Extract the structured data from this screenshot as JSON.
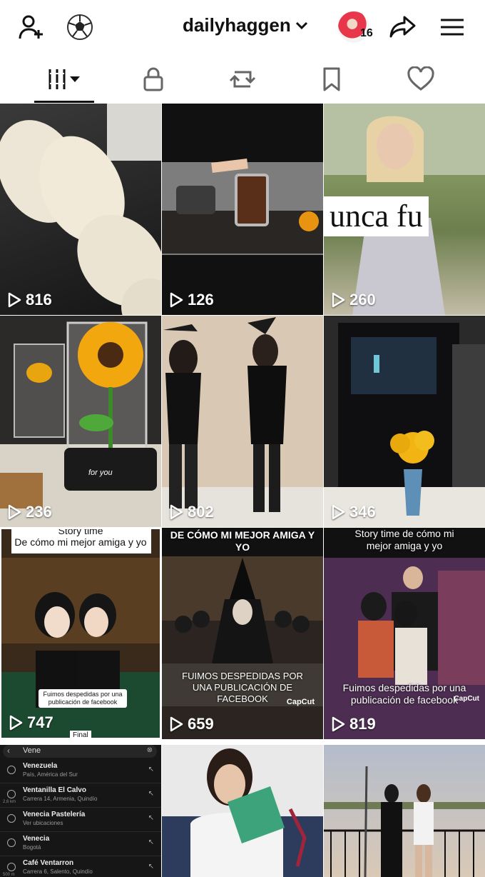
{
  "header": {
    "username": "dailyhaggen",
    "notification_count": "16",
    "icons": [
      "add-friend-icon",
      "soccer-ball-icon",
      "chevron-down-icon",
      "share-icon",
      "menu-icon"
    ]
  },
  "tabs": [
    {
      "name": "videos",
      "icon": "grid-icon",
      "active": true
    },
    {
      "name": "private",
      "icon": "lock-icon"
    },
    {
      "name": "reposts",
      "icon": "repost-icon"
    },
    {
      "name": "favorites",
      "icon": "bookmark-icon"
    },
    {
      "name": "liked",
      "icon": "heart-icon"
    }
  ],
  "videos": [
    {
      "views": "816"
    },
    {
      "views": "126"
    },
    {
      "views": "260",
      "overlay_text": "unca fu"
    },
    {
      "views": "236",
      "overlay_text": "for you"
    },
    {
      "views": "802"
    },
    {
      "views": "346"
    },
    {
      "views": "747",
      "caption_top_a": "Story time",
      "caption_top_b": "De cómo mi mejor amiga y yo",
      "caption_bottom": "Fuimos despedidas por una publicación de facebook",
      "badge": "Final"
    },
    {
      "views": "659",
      "caption_top": "DE CÓMO MI MEJOR AMIGA Y YO",
      "caption_bottom": "FUIMOS DESPEDIDAS POR UNA PUBLICACIÓN DE FACEBOOK",
      "watermark": "CapCut"
    },
    {
      "views": "819",
      "caption_top": "Story time de cómo mi mejor amiga y yo",
      "caption_bottom": "Fuimos despedidas por una publicación de facebook",
      "watermark": "CapCut"
    }
  ],
  "search_tile": {
    "query": "Vene",
    "results": [
      {
        "title": "Venezuela",
        "subtitle": "País, América del Sur"
      },
      {
        "title": "Ventanilla El Calvo",
        "subtitle": "Carrera 14, Armenia, Quindío",
        "distance": "2,6 km"
      },
      {
        "title": "Venecia Pastelería",
        "subtitle": "Ver ubicaciones"
      },
      {
        "title": "Venecia",
        "subtitle": "Bogotá"
      },
      {
        "title": "Café Ventarron",
        "subtitle": "Carrera 6, Salento, Quindío",
        "distance": "500 m"
      }
    ]
  },
  "colors": {
    "text": "#111111",
    "background": "#ffffff",
    "accent": "#e8374a"
  }
}
